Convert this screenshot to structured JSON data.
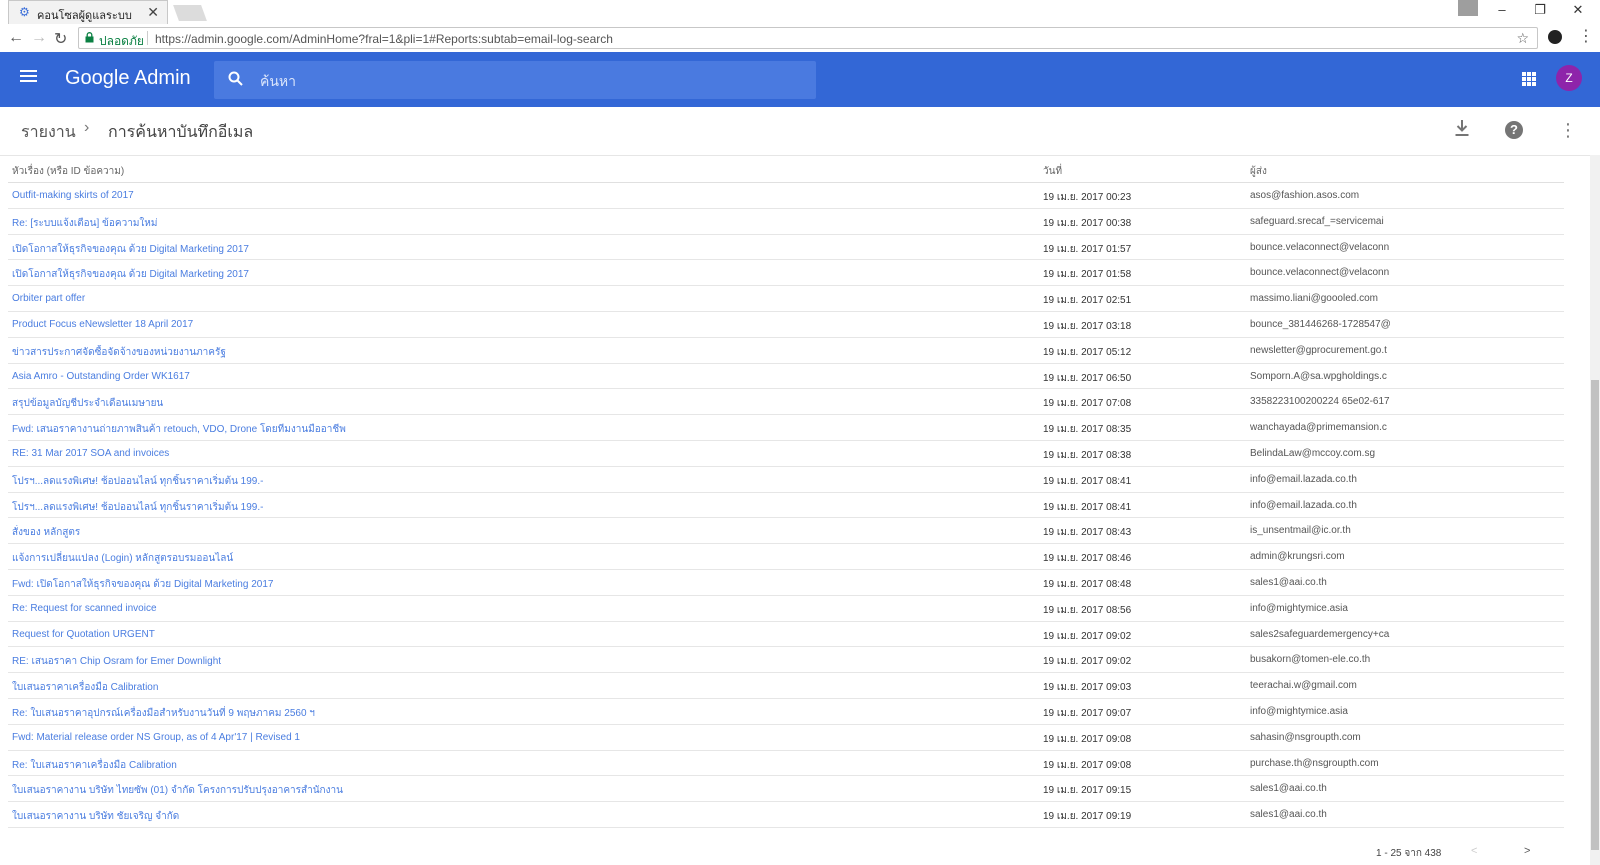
{
  "browser": {
    "tab_title": "คอนโซลผู้ดูแลระบบ",
    "secure_label": "ปลอดภัย",
    "url": "https://admin.google.com/AdminHome?fral=1&pli=1#Reports:subtab=email-log-search"
  },
  "header": {
    "brand": "Google Admin",
    "search_placeholder": "ค้นหา",
    "avatar_initial": "Z"
  },
  "breadcrumb": {
    "root": "รายงาน",
    "separator": "›",
    "current": "การค้นหาบันทึกอีเมล"
  },
  "table": {
    "columns": {
      "subject": "หัวเรื่อง (หรือ ID ข้อความ)",
      "date": "วันที่",
      "sender": "ผู้ส่ง"
    },
    "rows": [
      {
        "subject": "Outfit-making skirts of 2017",
        "date": "19 เม.ย. 2017 00:23",
        "sender": "asos@fashion.asos.com"
      },
      {
        "subject": "Re: [ระบบแจ้งเตือน] ข้อความใหม่",
        "date": "19 เม.ย. 2017 00:38",
        "sender": "safeguard.srecaf_=servicemai"
      },
      {
        "subject": "เปิดโอกาสให้ธุรกิจของคุณ ด้วย Digital Marketing 2017",
        "date": "19 เม.ย. 2017 01:57",
        "sender": "bounce.velaconnect@velaconn"
      },
      {
        "subject": "เปิดโอกาสให้ธุรกิจของคุณ ด้วย Digital Marketing 2017",
        "date": "19 เม.ย. 2017 01:58",
        "sender": "bounce.velaconnect@velaconn"
      },
      {
        "subject": "Orbiter part offer",
        "date": "19 เม.ย. 2017 02:51",
        "sender": "massimo.liani@goooled.com"
      },
      {
        "subject": "Product Focus eNewsletter 18 April 2017",
        "date": "19 เม.ย. 2017 03:18",
        "sender": "bounce_381446268-1728547@"
      },
      {
        "subject": "ข่าวสารประกาศจัดซื้อจัดจ้างของหน่วยงานภาครัฐ",
        "date": "19 เม.ย. 2017 05:12",
        "sender": "newsletter@gprocurement.go.t"
      },
      {
        "subject": "Asia Amro - Outstanding Order WK1617",
        "date": "19 เม.ย. 2017 06:50",
        "sender": "Somporn.A@sa.wpgholdings.c"
      },
      {
        "subject": "สรุปข้อมูลบัญชีประจำเดือนเมษายน",
        "date": "19 เม.ย. 2017 07:08",
        "sender": "3358223100200224 65e02-617"
      },
      {
        "subject": "Fwd: เสนอราคางานถ่ายภาพสินค้า retouch, VDO, Drone โดยทีมงานมืออาชีพ",
        "date": "19 เม.ย. 2017 08:35",
        "sender": "wanchayada@primemansion.c"
      },
      {
        "subject": "RE: 31 Mar 2017 SOA and invoices",
        "date": "19 เม.ย. 2017 08:38",
        "sender": "BelindaLaw@mccoy.com.sg"
      },
      {
        "subject": "โปรฯ...ลดแรงพิเศษ! ช้อปออนไลน์ ทุกชิ้นราคาเริ่มต้น 199.-",
        "date": "19 เม.ย. 2017 08:41",
        "sender": "info@email.lazada.co.th"
      },
      {
        "subject": "โปรฯ...ลดแรงพิเศษ! ช้อปออนไลน์ ทุกชิ้นราคาเริ่มต้น 199.-",
        "date": "19 เม.ย. 2017 08:41",
        "sender": "info@email.lazada.co.th"
      },
      {
        "subject": "สั่งของ หลักสูตร",
        "date": "19 เม.ย. 2017 08:43",
        "sender": "is_unsentmail@ic.or.th"
      },
      {
        "subject": "แจ้งการเปลี่ยนแปลง (Login) หลักสูตรอบรมออนไลน์",
        "date": "19 เม.ย. 2017 08:46",
        "sender": "admin@krungsri.com"
      },
      {
        "subject": "Fwd: เปิดโอกาสให้ธุรกิจของคุณ ด้วย Digital Marketing 2017",
        "date": "19 เม.ย. 2017 08:48",
        "sender": "sales1@aai.co.th"
      },
      {
        "subject": "Re: Request for scanned invoice",
        "date": "19 เม.ย. 2017 08:56",
        "sender": "info@mightymice.asia"
      },
      {
        "subject": "Request for Quotation URGENT",
        "date": "19 เม.ย. 2017 09:02",
        "sender": "sales2safeguardemergency+ca"
      },
      {
        "subject": "RE: เสนอราคา Chip Osram for Emer Downlight",
        "date": "19 เม.ย. 2017 09:02",
        "sender": "busakorn@tomen-ele.co.th"
      },
      {
        "subject": "ใบเสนอราคาเครื่องมือ Calibration",
        "date": "19 เม.ย. 2017 09:03",
        "sender": "teerachai.w@gmail.com"
      },
      {
        "subject": "Re: ใบเสนอราคาอุปกรณ์เครื่องมือสำหรับงานวันที่ 9 พฤษภาคม 2560 ฯ",
        "date": "19 เม.ย. 2017 09:07",
        "sender": "info@mightymice.asia"
      },
      {
        "subject": "Fwd: Material release order NS Group, as of 4 Apr'17 | Revised 1",
        "date": "19 เม.ย. 2017 09:08",
        "sender": "sahasin@nsgroupth.com"
      },
      {
        "subject": "Re: ใบเสนอราคาเครื่องมือ Calibration",
        "date": "19 เม.ย. 2017 09:08",
        "sender": "purchase.th@nsgroupth.com"
      },
      {
        "subject": "ใบเสนอราคางาน บริษัท ไทยซัพ (01) จำกัด โครงการปรับปรุงอาคารสำนักงาน",
        "date": "19 เม.ย. 2017 09:15",
        "sender": "sales1@aai.co.th"
      },
      {
        "subject": "ใบเสนอราคางาน บริษัท ชัยเจริญ จำกัด",
        "date": "19 เม.ย. 2017 09:19",
        "sender": "sales1@aai.co.th"
      }
    ]
  },
  "pagination": {
    "label": "1 - 25 จาก 438",
    "prev": "<",
    "next": ">"
  },
  "icons": {
    "back": "←",
    "forward": "→",
    "reload": "↻",
    "lock": "🔒",
    "star": "☆",
    "close": "✕",
    "download": "⬇",
    "help": "?",
    "more": "⋮"
  },
  "colors": {
    "appbar": "#3367d6",
    "link": "#4a7de0",
    "avatar": "#8e24aa"
  }
}
